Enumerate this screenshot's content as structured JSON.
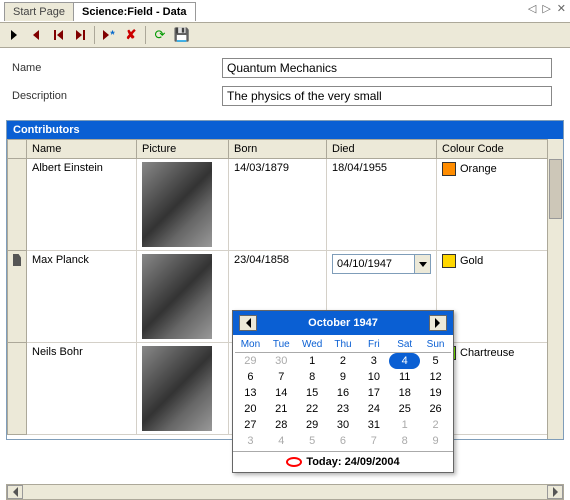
{
  "tabs": {
    "start": "Start Page",
    "active": "Science:Field - Data"
  },
  "form": {
    "name_lbl": "Name",
    "name_val": "Quantum Mechanics",
    "desc_lbl": "Description",
    "desc_val": "The physics of the very small"
  },
  "grid": {
    "title": "Contributors",
    "cols": {
      "name": "Name",
      "pic": "Picture",
      "born": "Born",
      "died": "Died",
      "cc": "Colour Code"
    },
    "rows": [
      {
        "name": "Albert Einstein",
        "born": "14/03/1879",
        "died": "18/04/1955",
        "cc": "Orange",
        "swatch": "#ff8c00"
      },
      {
        "name": "Max Planck",
        "born": "23/04/1858",
        "died": "04/10/1947",
        "cc": "Gold",
        "swatch": "#ffd700",
        "editing": true
      },
      {
        "name": "Neils Bohr",
        "born": "",
        "died": "",
        "cc": "Chartreuse",
        "swatch": "#7fff00"
      }
    ]
  },
  "calendar": {
    "title": "October 1947",
    "dow": [
      "Mon",
      "Tue",
      "Wed",
      "Thu",
      "Fri",
      "Sat",
      "Sun"
    ],
    "weeks": [
      [
        {
          "d": 29,
          "off": true
        },
        {
          "d": 30,
          "off": true
        },
        {
          "d": 1
        },
        {
          "d": 2
        },
        {
          "d": 3
        },
        {
          "d": 4,
          "sel": true
        },
        {
          "d": 5
        }
      ],
      [
        {
          "d": 6
        },
        {
          "d": 7
        },
        {
          "d": 8
        },
        {
          "d": 9
        },
        {
          "d": 10
        },
        {
          "d": 11
        },
        {
          "d": 12
        }
      ],
      [
        {
          "d": 13
        },
        {
          "d": 14
        },
        {
          "d": 15
        },
        {
          "d": 16
        },
        {
          "d": 17
        },
        {
          "d": 18
        },
        {
          "d": 19
        }
      ],
      [
        {
          "d": 20
        },
        {
          "d": 21
        },
        {
          "d": 22
        },
        {
          "d": 23
        },
        {
          "d": 24
        },
        {
          "d": 25
        },
        {
          "d": 26
        }
      ],
      [
        {
          "d": 27
        },
        {
          "d": 28
        },
        {
          "d": 29
        },
        {
          "d": 30
        },
        {
          "d": 31
        },
        {
          "d": 1,
          "off": true
        },
        {
          "d": 2,
          "off": true
        }
      ],
      [
        {
          "d": 3,
          "off": true
        },
        {
          "d": 4,
          "off": true
        },
        {
          "d": 5,
          "off": true
        },
        {
          "d": 6,
          "off": true
        },
        {
          "d": 7,
          "off": true
        },
        {
          "d": 8,
          "off": true
        },
        {
          "d": 9,
          "off": true
        }
      ]
    ],
    "today": "Today: 24/09/2004"
  }
}
